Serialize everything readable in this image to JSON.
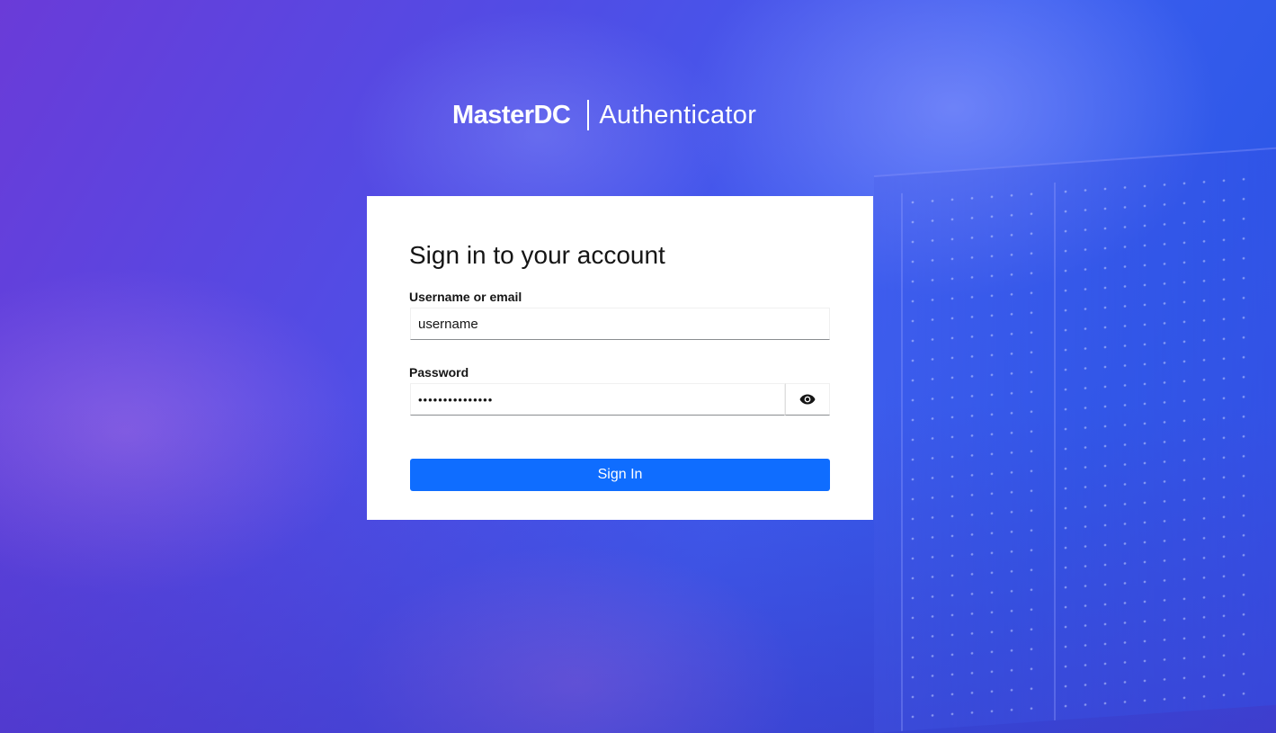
{
  "brand": {
    "logo_text": "MasterDC",
    "product_name": "Authenticator"
  },
  "login": {
    "title": "Sign in to your account",
    "username_label": "Username or email",
    "username_value": "username",
    "password_label": "Password",
    "password_value": "•••••••••••••••",
    "show_password_icon": "eye-icon",
    "submit_label": "Sign In"
  },
  "colors": {
    "primary_button": "#0f6dff",
    "card_background": "#ffffff",
    "background_start": "#6a3bd8",
    "background_end": "#2e58e8"
  }
}
